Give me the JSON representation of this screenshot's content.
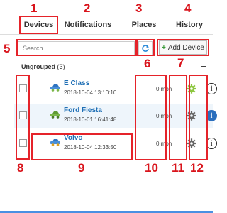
{
  "tabs": [
    {
      "number": "1",
      "label": "Devices"
    },
    {
      "number": "2",
      "label": "Notifications"
    },
    {
      "number": "3",
      "label": "Places"
    },
    {
      "number": "4",
      "label": "History"
    }
  ],
  "toolbar": {
    "search_number": "5",
    "search_placeholder": "Search",
    "refresh_number": "6",
    "add_number": "7",
    "add_label": "Add Device"
  },
  "group": {
    "name": "Ungrouped",
    "count": "(3)",
    "collapse_symbol": "–"
  },
  "vehicles": [
    {
      "name": "E Class",
      "datetime": "2018-10-04 13:10:10",
      "speed": "0 mph",
      "gear_status": "active"
    },
    {
      "name": "Ford Fiesta",
      "datetime": "2018-10-01 16:41:48",
      "speed": "0 mph",
      "gear_status": "inactive"
    },
    {
      "name": "Volvo",
      "datetime": "2018-10-04 12:33:50",
      "speed": "0 mph",
      "gear_status": "inactive"
    }
  ],
  "column_numbers": {
    "checkbox": "8",
    "vehicle": "9",
    "speed": "10",
    "settings": "11",
    "info": "12"
  },
  "colors": {
    "annotation_red": "#e5232a",
    "link_blue": "#1f6fb5",
    "gear_active": "#8cc63f",
    "gear_inactive": "#666666",
    "info_blue": "#2a6ebd",
    "row_alt": "#eef5fb"
  },
  "icons": {
    "refresh": "refresh-icon",
    "add": "plus-icon",
    "car": "car-icon",
    "settings": "gear-icon",
    "info": "info-icon"
  }
}
